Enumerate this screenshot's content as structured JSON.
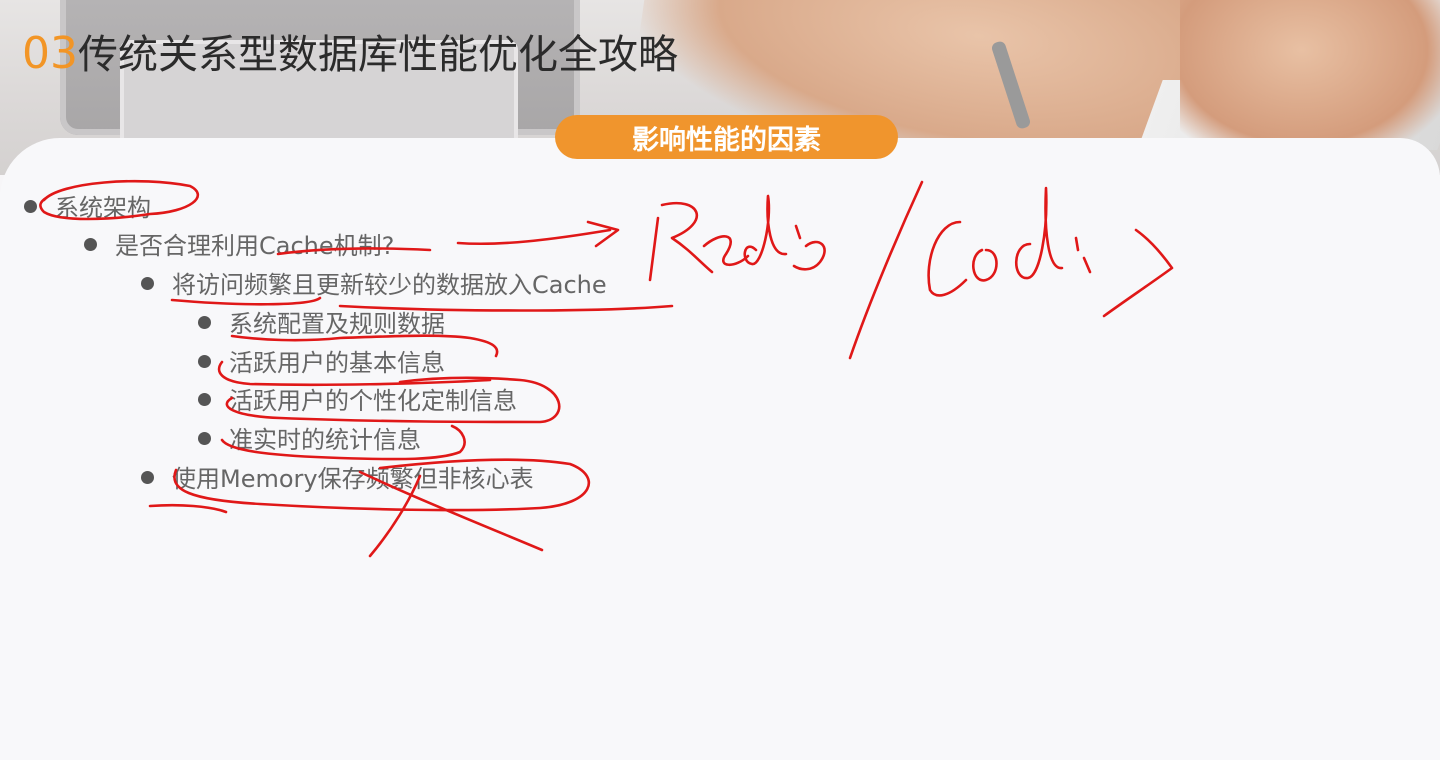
{
  "slide": {
    "title_number": "03",
    "title_text": "传统关系型数据库性能优化全攻略",
    "section_pill": "影响性能的因素"
  },
  "outline": [
    {
      "level": 1,
      "text": "系统架构"
    },
    {
      "level": 2,
      "text": "是否合理利用Cache机制?"
    },
    {
      "level": 3,
      "text": "将访问频繁且更新较少的数据放入Cache"
    },
    {
      "level": 4,
      "text": "系统配置及规则数据"
    },
    {
      "level": 4,
      "text": "活跃用户的基本信息"
    },
    {
      "level": 4,
      "text": "活跃用户的个性化定制信息"
    },
    {
      "level": 4,
      "text": "准实时的统计信息"
    },
    {
      "level": 3,
      "text": "使用Memory保存频繁但非核心表"
    }
  ],
  "colors": {
    "accent_orange": "#f0952d",
    "annotation_red": "#e01818",
    "text_gray": "#666666"
  }
}
